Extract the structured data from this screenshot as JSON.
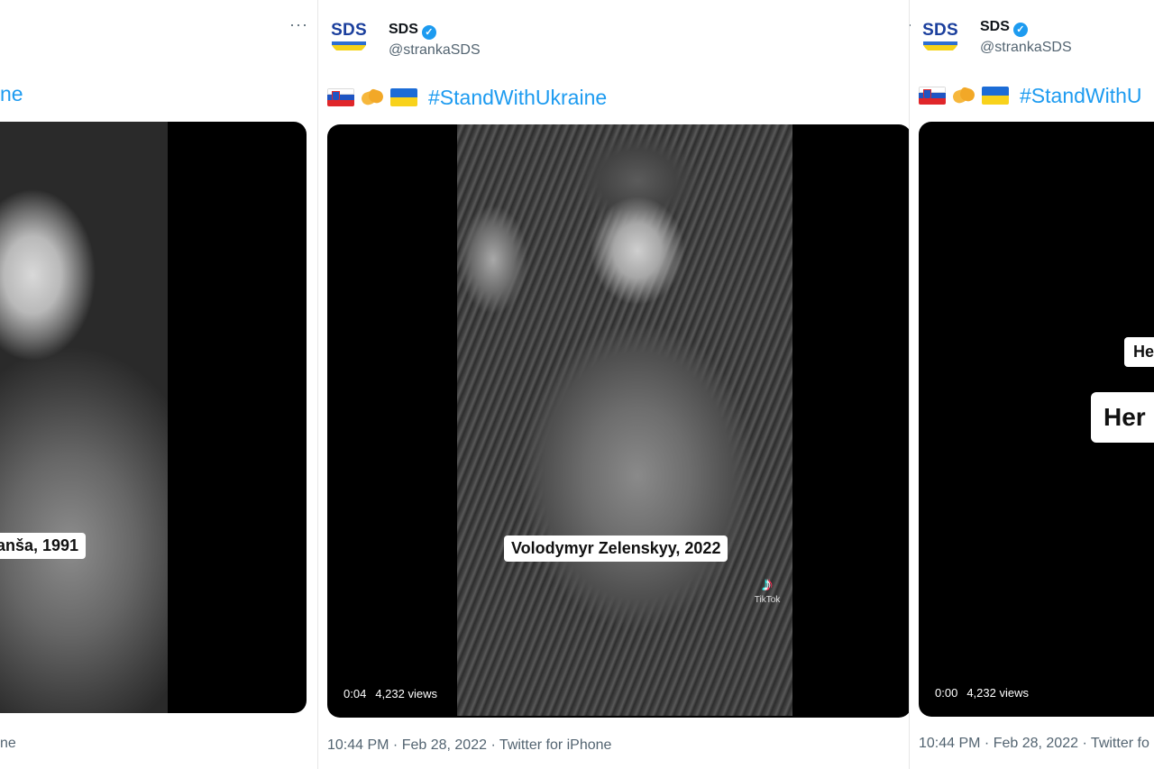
{
  "panels": {
    "left": {
      "hashtag_fragment": "ne",
      "caption": "anša, 1991",
      "footer_fragment": "ne"
    },
    "center": {
      "account": {
        "avatar_text": "SDS",
        "display_name": "SDS",
        "handle": "@strankaSDS"
      },
      "tweet": {
        "hashtag": "#StandWithUkraine"
      },
      "video": {
        "caption": "Volodymyr Zelenskyy, 2022",
        "elapsed": "0:04",
        "views": "4,232 views",
        "tiktok_label": "TikTok"
      },
      "timestamp": "10:44 PM · Feb 28, 2022 · Twitter for iPhone"
    },
    "right": {
      "account": {
        "avatar_text": "SDS",
        "display_name": "SDS",
        "handle": "@strankaSDS"
      },
      "tweet": {
        "hashtag": "#StandWithU"
      },
      "video": {
        "caption_small": "He",
        "caption_large": "Her",
        "elapsed": "0:00",
        "views": "4,232 views"
      },
      "timestamp": "10:44 PM · Feb 28, 2022 · Twitter fo"
    }
  },
  "icons": {
    "more": "more-icon",
    "verified": "verified-badge-icon",
    "flag_si": "slovenia-flag-icon",
    "handshake": "handshake-icon",
    "flag_ua": "ukraine-flag-icon",
    "tiktok": "tiktok-icon"
  },
  "colors": {
    "link": "#1d9bf0",
    "text": "#0f1419",
    "muted": "#536471",
    "media_bg": "#000000"
  }
}
